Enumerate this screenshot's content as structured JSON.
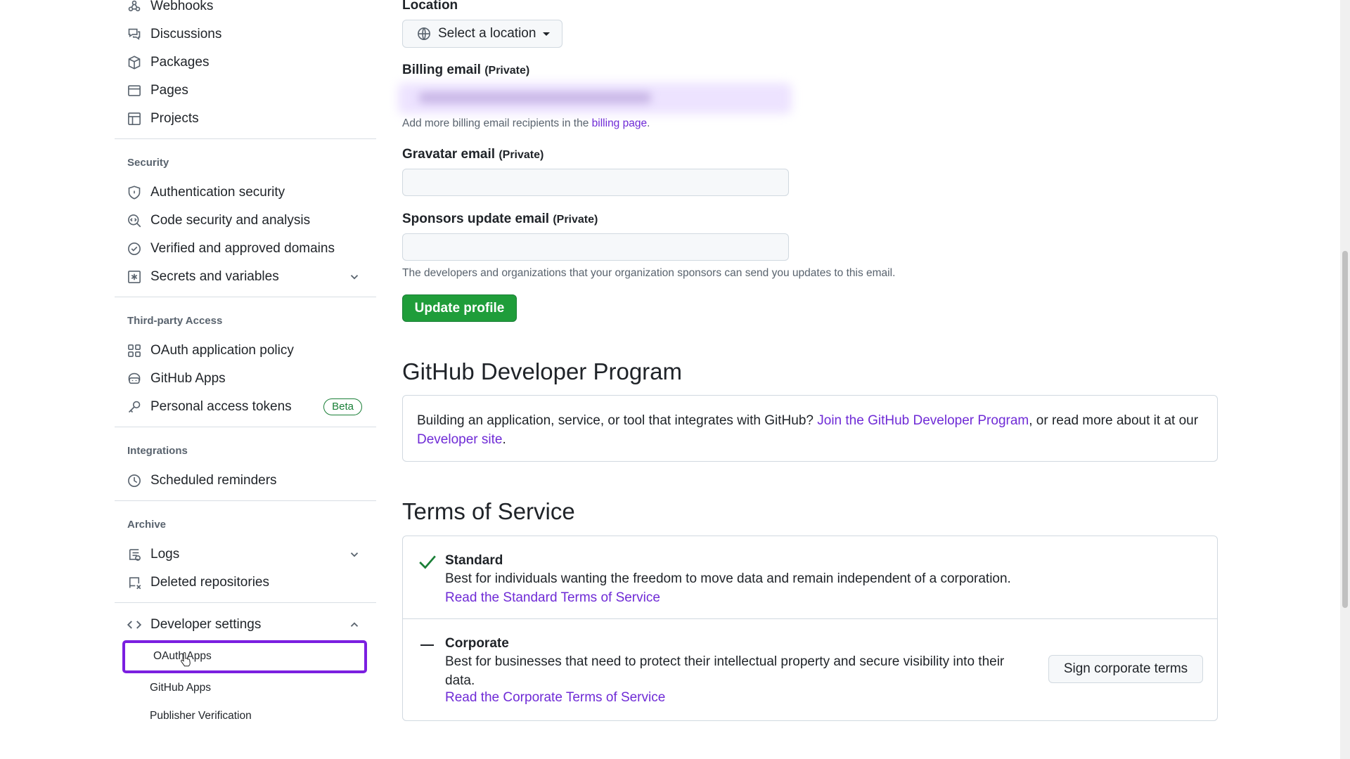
{
  "sidebar": {
    "top_items": [
      "Webhooks",
      "Discussions",
      "Packages",
      "Pages",
      "Projects"
    ],
    "security": {
      "heading": "Security",
      "items": [
        "Authentication security",
        "Code security and analysis",
        "Verified and approved domains",
        "Secrets and variables"
      ]
    },
    "third_party": {
      "heading": "Third-party Access",
      "items": [
        "OAuth application policy",
        "GitHub Apps",
        "Personal access tokens"
      ],
      "beta_badge": "Beta"
    },
    "integrations": {
      "heading": "Integrations",
      "items": [
        "Scheduled reminders"
      ]
    },
    "archive": {
      "heading": "Archive",
      "items": [
        "Logs",
        "Deleted repositories"
      ]
    },
    "developer": {
      "label": "Developer settings",
      "subitems": [
        "OAuth Apps",
        "GitHub Apps",
        "Publisher Verification"
      ]
    }
  },
  "main": {
    "location": {
      "label": "Location",
      "button": "Select a location"
    },
    "billing_email": {
      "label": "Billing email",
      "private": "(Private)",
      "note_prefix": "Add more billing email recipients in the",
      "note_link": "billing page",
      "note_suffix": "."
    },
    "gravatar_email": {
      "label": "Gravatar email",
      "private": "(Private)",
      "value": ""
    },
    "sponsors_email": {
      "label": "Sponsors update email",
      "private": "(Private)",
      "value": "",
      "note": "The developers and organizations that your organization sponsors can send you updates to this email."
    },
    "update_button": "Update profile",
    "dev_program": {
      "title": "GitHub Developer Program",
      "text_prefix": "Building an application, service, or tool that integrates with GitHub?",
      "link1": "Join the GitHub Developer Program",
      "text_mid": ", or read more about it at our",
      "link2": "Developer site",
      "text_suffix": "."
    },
    "tos": {
      "title": "Terms of Service",
      "standard": {
        "name": "Standard",
        "desc": "Best for individuals wanting the freedom to move data and remain independent of a corporation.",
        "link": "Read the Standard Terms of Service"
      },
      "corporate": {
        "name": "Corporate",
        "desc": "Best for businesses that need to protect their intellectual property and secure visibility into their data.",
        "link": "Read the Corporate Terms of Service",
        "button": "Sign corporate terms"
      }
    }
  },
  "colors": {
    "accent": "#6f2bd6",
    "green": "#1f9d3a",
    "focus": "#7b1fe0"
  }
}
